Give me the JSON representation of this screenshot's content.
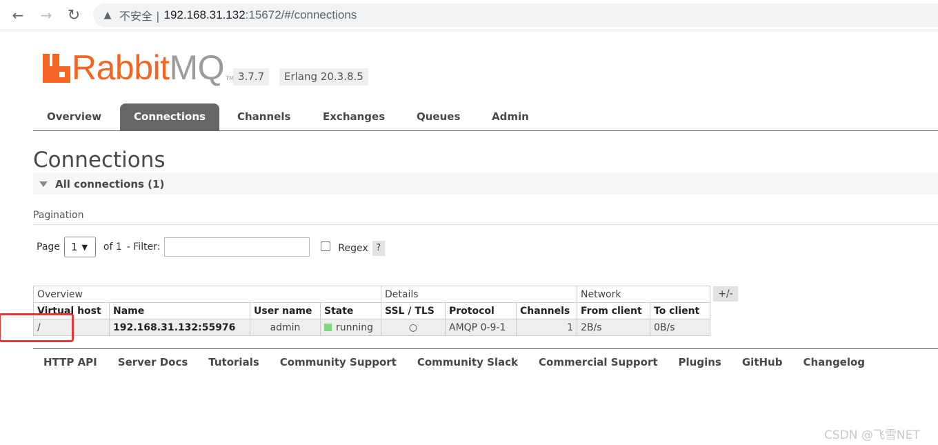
{
  "browser": {
    "security_label": "不安全",
    "url_host": "192.168.31.132",
    "url_rest": ":15672/#/connections"
  },
  "logo": {
    "brand_orange": "Rabbit",
    "brand_grey": "MQ",
    "tm": "TM",
    "version": "3.7.7",
    "erlang": "Erlang 20.3.8.5",
    "color": "#f26522"
  },
  "tabs": [
    {
      "label": "Overview",
      "active": false
    },
    {
      "label": "Connections",
      "active": true
    },
    {
      "label": "Channels",
      "active": false
    },
    {
      "label": "Exchanges",
      "active": false
    },
    {
      "label": "Queues",
      "active": false
    },
    {
      "label": "Admin",
      "active": false
    }
  ],
  "page_title": "Connections",
  "section_title": "All connections (1)",
  "pagination": {
    "label": "Pagination",
    "page_label": "Page",
    "page_value": "1",
    "of_label": "of 1",
    "filter_label": "- Filter:",
    "filter_value": "",
    "regex_label": "Regex",
    "help": "?"
  },
  "table": {
    "groups": [
      "Overview",
      "Details",
      "Network"
    ],
    "toggle": "+/-",
    "columns": [
      "Virtual host",
      "Name",
      "User name",
      "State",
      "SSL / TLS",
      "Protocol",
      "Channels",
      "From client",
      "To client"
    ],
    "rows": [
      {
        "vhost": "/",
        "name": "192.168.31.132:55976",
        "user": "admin",
        "state": "running",
        "ssl": "○",
        "protocol": "AMQP 0-9-1",
        "channels": "1",
        "from_client": "2B/s",
        "to_client": "0B/s"
      }
    ],
    "state_color": "#80d880"
  },
  "footer": [
    "HTTP API",
    "Server Docs",
    "Tutorials",
    "Community Support",
    "Community Slack",
    "Commercial Support",
    "Plugins",
    "GitHub",
    "Changelog"
  ],
  "watermark": "CSDN @飞雪NET",
  "icons": {
    "back": "arrow-left-icon",
    "forward": "arrow-right-icon",
    "reload": "reload-icon",
    "warning": "warning-icon"
  }
}
